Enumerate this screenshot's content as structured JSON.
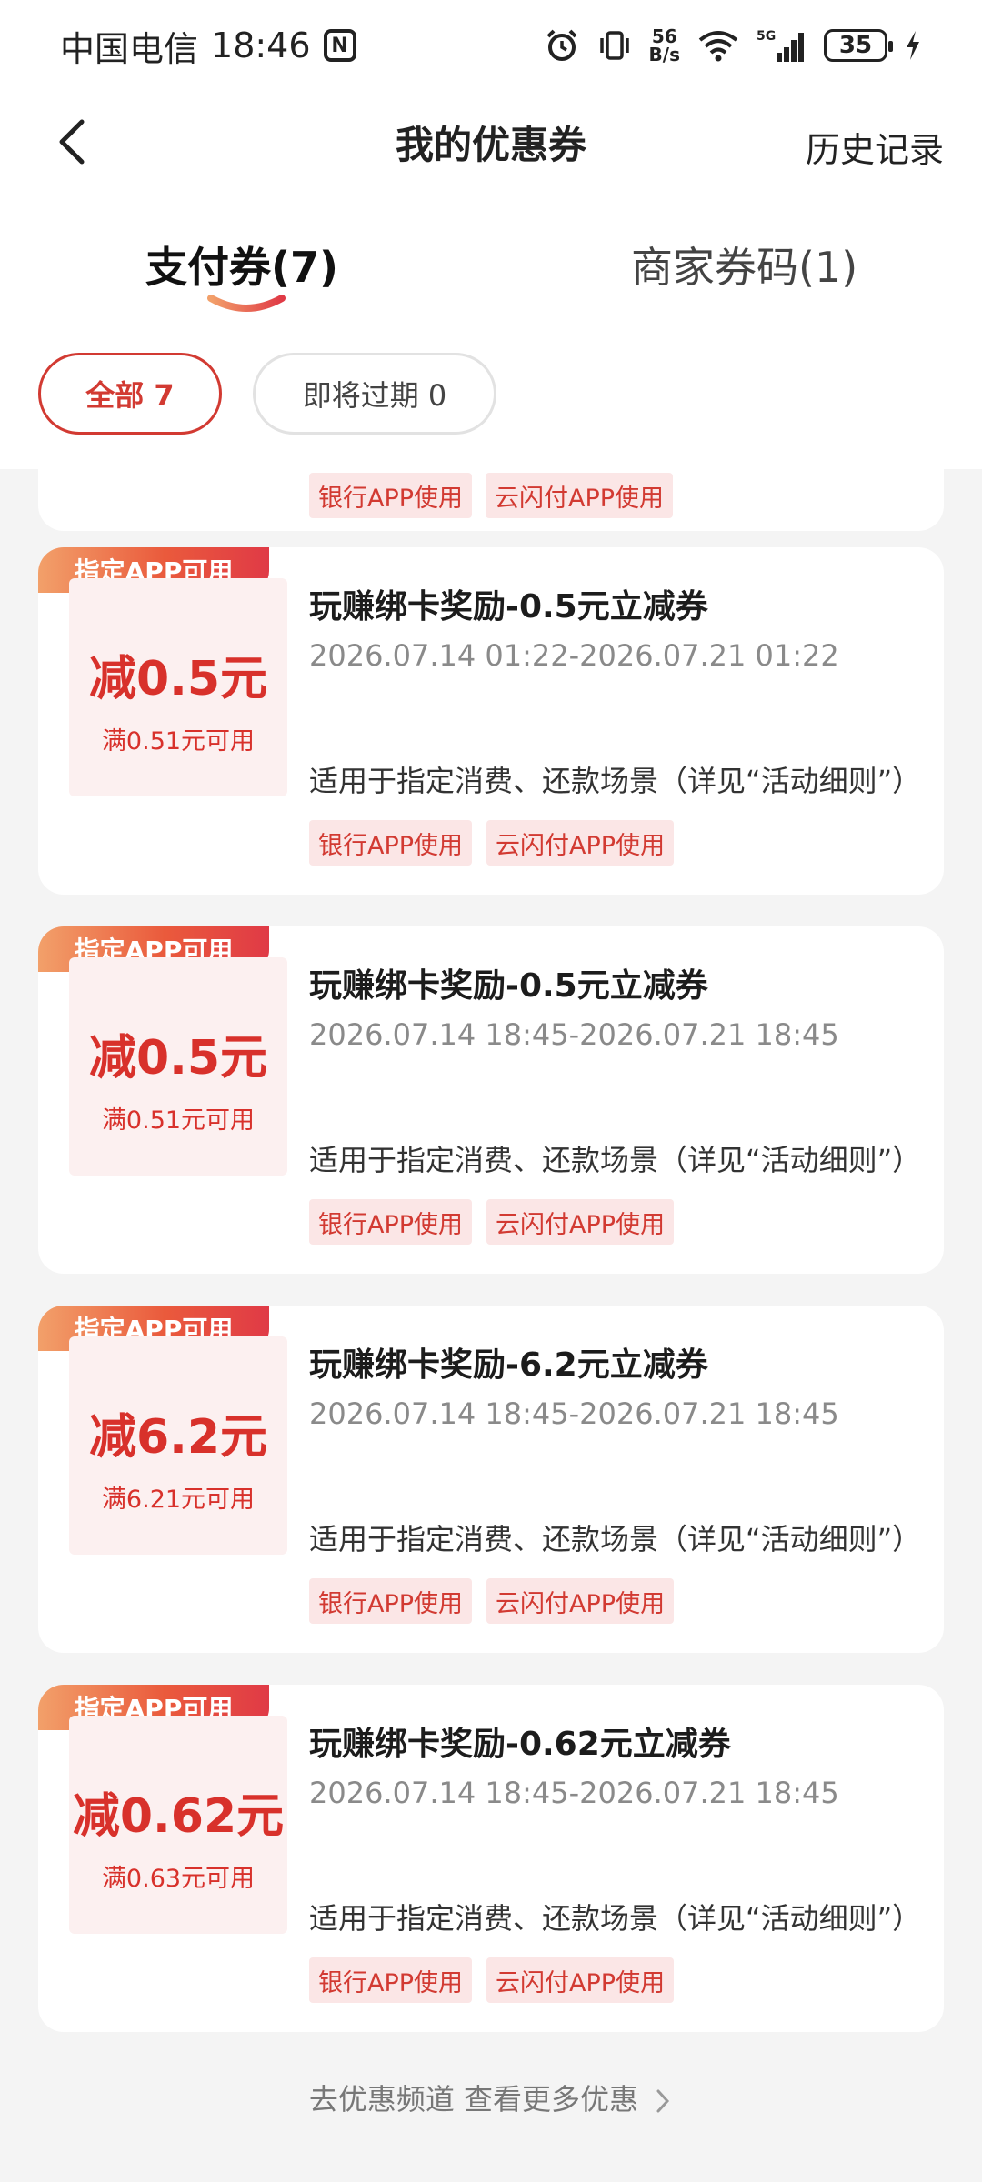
{
  "status_bar": {
    "carrier": "中国电信",
    "time": "18:46",
    "net_speed_top": "56",
    "net_speed_bottom": "B/s",
    "battery": "35",
    "icons": [
      "nfc-icon",
      "alarm-icon",
      "vibrate-icon",
      "wifi-icon",
      "signal-5g-icon",
      "battery-icon",
      "charging-bolt-icon"
    ]
  },
  "header": {
    "title": "我的优惠券",
    "history": "历史记录",
    "back_icon": "chevron-left-icon"
  },
  "tabs": [
    {
      "label": "支付券(7)",
      "active": true
    },
    {
      "label": "商家券码(1)",
      "active": false
    }
  ],
  "filters": [
    {
      "label": "全部 7",
      "selected": true
    },
    {
      "label": "即将过期 0",
      "selected": false
    }
  ],
  "partial_card": {
    "tags": [
      "银行APP使用",
      "云闪付APP使用"
    ]
  },
  "coupons": [
    {
      "badge": "指定APP可用",
      "amount": "减0.5元",
      "condition": "满0.51元可用",
      "title": "玩赚绑卡奖励-0.5元立减券",
      "date_range": "2026.07.14 01:22-2026.07.21 01:22",
      "description": "适用于指定消费、还款场景（详见“活动细则”）",
      "tags": [
        "银行APP使用",
        "云闪付APP使用"
      ]
    },
    {
      "badge": "指定APP可用",
      "amount": "减0.5元",
      "condition": "满0.51元可用",
      "title": "玩赚绑卡奖励-0.5元立减券",
      "date_range": "2026.07.14 18:45-2026.07.21 18:45",
      "description": "适用于指定消费、还款场景（详见“活动细则”）",
      "tags": [
        "银行APP使用",
        "云闪付APP使用"
      ]
    },
    {
      "badge": "指定APP可用",
      "amount": "减6.2元",
      "condition": "满6.21元可用",
      "title": "玩赚绑卡奖励-6.2元立减券",
      "date_range": "2026.07.14 18:45-2026.07.21 18:45",
      "description": "适用于指定消费、还款场景（详见“活动细则”）",
      "tags": [
        "银行APP使用",
        "云闪付APP使用"
      ]
    },
    {
      "badge": "指定APP可用",
      "amount": "减0.62元",
      "condition": "满0.63元可用",
      "title": "玩赚绑卡奖励-0.62元立减券",
      "date_range": "2026.07.14 18:45-2026.07.21 18:45",
      "description": "适用于指定消费、还款场景（详见“活动细则”）",
      "tags": [
        "银行APP使用",
        "云闪付APP使用"
      ]
    }
  ],
  "footer": {
    "link": "去优惠频道 查看更多优惠"
  },
  "colors": {
    "accent": "#d23a32",
    "badge_gradient_start": "#f2a06a",
    "badge_gradient_end": "#e03a46",
    "tag_bg": "#fbe6e6",
    "page_bg": "#f4f4f4"
  }
}
